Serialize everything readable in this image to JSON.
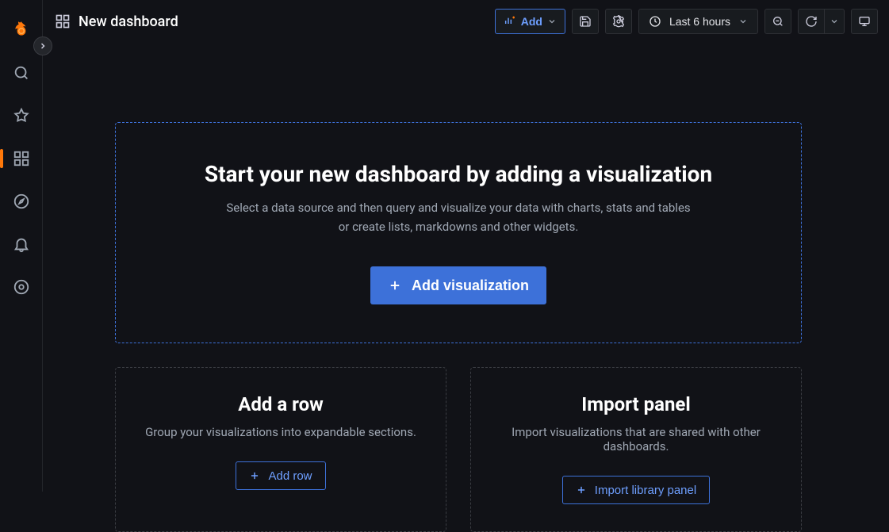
{
  "page": {
    "title": "New dashboard"
  },
  "toolbar": {
    "add_label": "Add",
    "time_label": "Last 6 hours"
  },
  "hero": {
    "title": "Start your new dashboard by adding a visualization",
    "body_line1": "Select a data source and then query and visualize your data with charts, stats and tables",
    "body_line2": "or create lists, markdowns and other widgets.",
    "cta": "Add visualization"
  },
  "cards": {
    "row": {
      "title": "Add a row",
      "body": "Group your visualizations into expandable sections.",
      "button": "Add row"
    },
    "import": {
      "title": "Import panel",
      "body": "Import visualizations that are shared with other dashboards.",
      "button": "Import library panel"
    }
  }
}
